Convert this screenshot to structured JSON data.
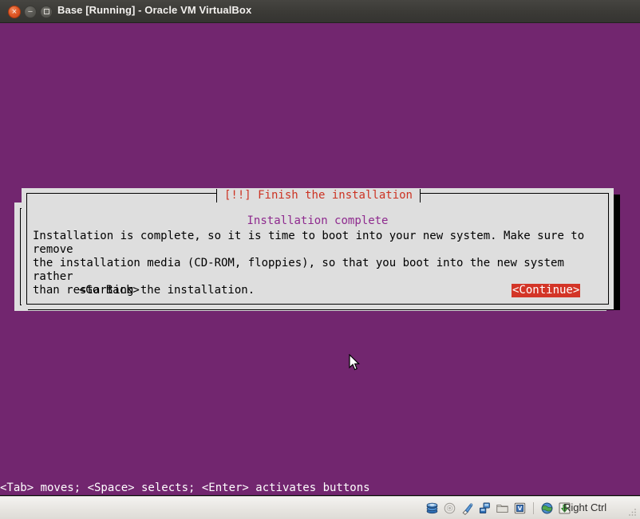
{
  "window": {
    "title": "Base [Running] - Oracle VM VirtualBox",
    "controls": {
      "close_label": "×",
      "minimize_label": "−",
      "maximize_label": ""
    }
  },
  "guest": {
    "background_color": "#72266f",
    "dialog": {
      "title": "[!!] Finish the installation",
      "title_color": "#cc3323",
      "heading": "Installation complete",
      "heading_color": "#8e2a8e",
      "body": "Installation is complete, so it is time to boot into your new system. Make sure to remove\nthe installation media (CD-ROM, floppies), so that you boot into the new system rather\nthan restarting the installation.",
      "buttons": {
        "go_back": "<Go Back>",
        "continue": "<Continue>",
        "continue_selected": true,
        "selected_bg_color": "#d33527",
        "selected_fg_color": "#ffffff"
      }
    },
    "hint_line": "<Tab> moves; <Space> selects; <Enter> activates buttons"
  },
  "statusbar": {
    "icons": [
      {
        "name": "hard-disk-icon",
        "title": "Hard Disks",
        "active": true
      },
      {
        "name": "cd-dvd-icon",
        "title": "CD/DVD Drive",
        "active": false
      },
      {
        "name": "usb-icon",
        "title": "USB Devices",
        "active": true
      },
      {
        "name": "network-icon",
        "title": "Network Adapters",
        "active": true
      },
      {
        "name": "shared-folders-icon",
        "title": "Shared Folders",
        "active": true
      },
      {
        "name": "display-icon",
        "title": "Virtual Machine Display",
        "active": true
      },
      {
        "name": "remote-desktop-icon",
        "title": "Remote Desktop",
        "active": true
      },
      {
        "name": "mouse-capture-icon",
        "title": "Mouse Integration",
        "active": true
      }
    ],
    "host_key_label": "Right Ctrl"
  }
}
